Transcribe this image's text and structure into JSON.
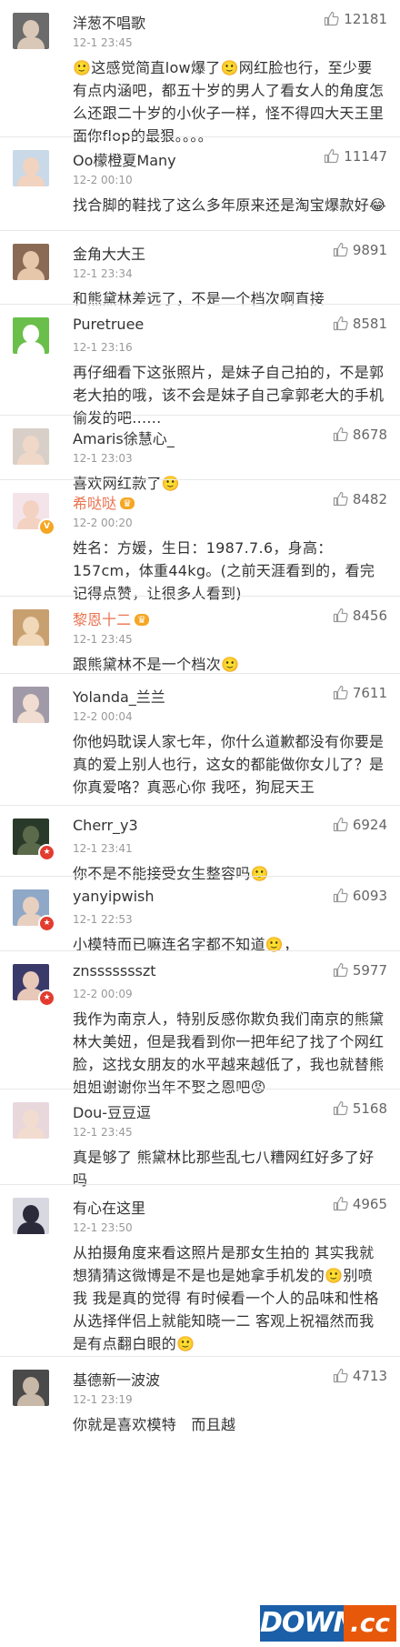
{
  "comments": [
    {
      "name": "洋葱不唱歌",
      "time": "12-1 23:45",
      "likes": "12181",
      "text": "🙂这感觉简直low爆了🙂网红脸也行，至少要有点内涵吧，都五十岁的男人了看女人的角度怎么还跟二十岁的小伙子一样，怪不得四大天王里面你flop的最狠。。。。",
      "avatar_bg": "#6b6b6b",
      "avatar_face": "#d9c8b8"
    },
    {
      "name": "Oo檬橙夏Many",
      "time": "12-2 00:10",
      "likes": "11147",
      "text": "找合脚的鞋找了这么多年原来还是淘宝爆款好😂",
      "avatar_bg": "#c9d9e8",
      "avatar_face": "#f2d3c0"
    },
    {
      "name": "金角大大王",
      "time": "12-1 23:34",
      "likes": "9891",
      "text": "和熊黛林差远了，不是一个档次啊直接",
      "avatar_bg": "#8a6a55",
      "avatar_face": "#e7c7aa"
    },
    {
      "name": "Puretruee",
      "time": "12-1 23:16",
      "likes": "8581",
      "text": "再仔细看下这张照片，是妹子自己拍的，不是郭老大拍的哦，该不会是妹子自己拿郭老大的手机偷发的吧......",
      "avatar_bg": "#6abf4b",
      "avatar_face": "#ffffff"
    },
    {
      "name": "Amaris徐慧心_",
      "time": "12-1 23:03",
      "likes": "8678",
      "text": "喜欢网红款了🙂",
      "avatar_bg": "#d8d0c8",
      "avatar_face": "#f0d8c8"
    },
    {
      "name": "希哒哒",
      "time": "12-2 00:20",
      "likes": "8482",
      "text": "姓名：方媛，生日：1987.7.6，身高：157cm，体重44kg。(之前天涯看到的，看完记得点赞，让很多人看到)",
      "avatar_bg": "#f4e4ea",
      "avatar_face": "#f3d2c2",
      "orange": true,
      "badge": "V"
    },
    {
      "name": "黎恩十二",
      "time": "12-1 23:45",
      "likes": "8456",
      "text": "跟熊黛林不是一个档次🙂",
      "avatar_bg": "#c8a070",
      "avatar_face": "#f0d8b8",
      "orange": true
    },
    {
      "name": "Yolanda_兰兰",
      "time": "12-2 00:04",
      "likes": "7611",
      "text": "你他妈耽误人家七年，你什么道歉都没有你要是真的爱上别人也行，这女的都能做你女儿了？是你真爱咯？真恶心你 我呸，狗屁天王",
      "avatar_bg": "#a09aa8",
      "avatar_face": "#f0dcd0"
    },
    {
      "name": "Cherr_y3",
      "time": "12-1 23:41",
      "likes": "6924",
      "text": "你不是不能接受女生整容吗🙂",
      "avatar_bg": "#2a3a2a",
      "avatar_face": "#5a6a4a",
      "badge": "★"
    },
    {
      "name": "yanyipwish",
      "time": "12-1 22:53",
      "likes": "6093",
      "text": "小模特而已嘛连名字都不知道🙂，",
      "avatar_bg": "#90a8c8",
      "avatar_face": "#e8d0c0",
      "badge": "★"
    },
    {
      "name": "znssssssszt",
      "time": "12-2 00:09",
      "likes": "5977",
      "text": "我作为南京人，特别反感你欺负我们南京的熊黛林大美妞，但是我看到你一把年纪了找了个网红脸，这找女朋友的水平越来越低了，我也就替熊姐姐谢谢你当年不娶之恩吧😡",
      "avatar_bg": "#3a3a6a",
      "avatar_face": "#e8c8b8",
      "badge": "★"
    },
    {
      "name": "Dou-豆豆逗",
      "time": "12-1 23:45",
      "likes": "5168",
      "text": "真是够了 熊黛林比那些乱七八糟网红好多了好吗",
      "avatar_bg": "#e8d8dc",
      "avatar_face": "#f2dcd0"
    },
    {
      "name": "有心在这里",
      "time": "12-1 23:50",
      "likes": "4965",
      "text": "从拍摄角度来看这照片是那女生拍的 其实我就想猜猜这微博是不是也是她拿手机发的🙂别喷我 我是真的觉得 有时候看一个人的品味和性格 从选择伴侣上就能知晓一二 客观上祝福然而我是有点翻白眼的🙂",
      "avatar_bg": "#d8d8e0",
      "avatar_face": "#2a2a3a"
    },
    {
      "name": "基德新一波波",
      "time": "12-1 23:19",
      "likes": "4713",
      "text": "你就是喜欢模特　而且越",
      "avatar_bg": "#4a4a4a",
      "avatar_face": "#c8b8a8"
    }
  ],
  "watermark": {
    "left": "DOWN",
    "right": ".cc"
  },
  "colors": {
    "name_orange": "#eb7350",
    "badge_orange": "#f5a623",
    "badge_red": "#e33b2f"
  }
}
